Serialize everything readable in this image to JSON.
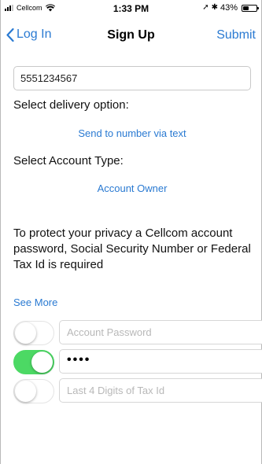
{
  "status_bar": {
    "carrier": "Cellcom",
    "time": "1:33 PM",
    "battery": "43%",
    "battery_level": 0.43
  },
  "nav": {
    "back_label": "Log In",
    "title": "Sign Up",
    "submit_label": "Submit"
  },
  "form": {
    "phone_value": "5551234567",
    "delivery_label": "Select delivery option:",
    "delivery_option": "Send to number via text",
    "account_type_label": "Select Account Type:",
    "account_type_option": "Account Owner",
    "privacy_text": "To protect your privacy a Cellcom account password, Social Security Number or Federal Tax Id is required",
    "see_more": "See More",
    "rows": [
      {
        "placeholder": "Account Password",
        "value": "",
        "toggle_on": false
      },
      {
        "placeholder": "",
        "value": "••••",
        "toggle_on": true
      },
      {
        "placeholder": "Last 4 Digits of Tax Id",
        "value": "",
        "toggle_on": false
      }
    ]
  },
  "colors": {
    "accent": "#2a7ad2",
    "toggle_on": "#4cd964"
  }
}
